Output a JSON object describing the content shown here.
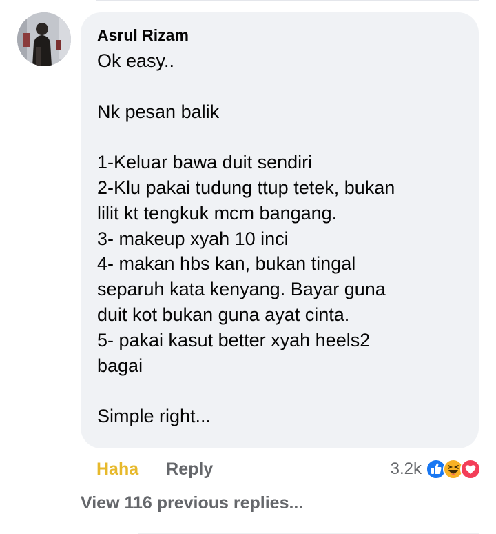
{
  "comment": {
    "author": "Asrul Rizam",
    "lines": [
      "Ok easy..",
      "",
      "Nk pesan balik",
      "",
      "1-Keluar bawa duit sendiri",
      "2-Klu pakai tudung ttup tetek, bukan",
      "lilit kt tengkuk mcm bangang.",
      "3- makeup xyah 10 inci",
      "4- makan hbs kan, bukan tingal",
      "separuh kata kenyang. Bayar guna",
      "duit kot bukan guna ayat cinta.",
      "5- pakai kasut better xyah heels2",
      "bagai",
      "",
      "Simple right..."
    ]
  },
  "actions": {
    "reaction_label": "Haha",
    "reply_label": "Reply"
  },
  "reactions": {
    "count": "3.2k",
    "icons": [
      "like-icon",
      "haha-icon",
      "love-icon"
    ],
    "colors": {
      "like": "#1877f2",
      "haha": "#f7b125",
      "love": "#f33e58"
    }
  },
  "view_previous": "View 116 previous replies...",
  "colors": {
    "bubble": "#f0f2f5",
    "text": "#050505",
    "secondary": "#65676b",
    "haha_label": "#e7b92c"
  }
}
